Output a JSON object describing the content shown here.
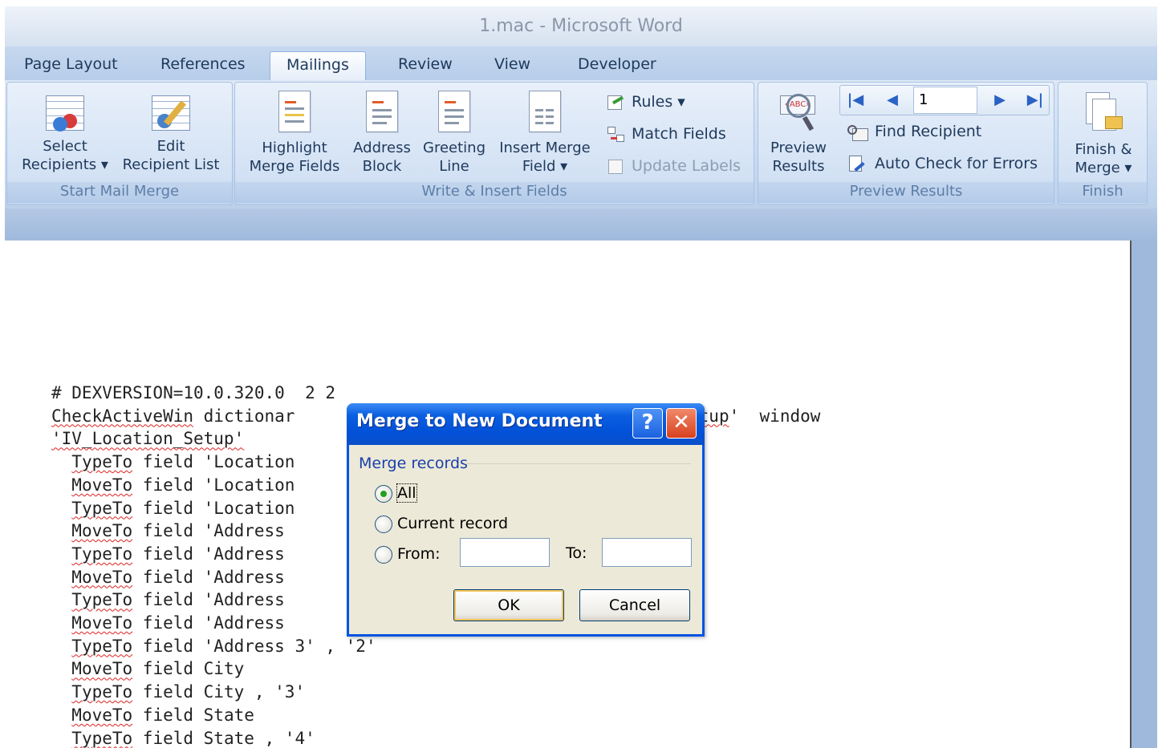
{
  "window": {
    "title": "1.mac - Microsoft Word"
  },
  "tabs": [
    {
      "label": "Page Layout"
    },
    {
      "label": "References"
    },
    {
      "label": "Mailings"
    },
    {
      "label": "Review"
    },
    {
      "label": "View"
    },
    {
      "label": "Developer"
    }
  ],
  "ribbon": {
    "start_group": {
      "label": "Start Mail Merge",
      "select_recipients": "Select\nRecipients ▾",
      "edit_recipient_list": "Edit\nRecipient List"
    },
    "write_group": {
      "label": "Write & Insert Fields",
      "highlight": "Highlight\nMerge Fields",
      "address_block": "Address\nBlock",
      "greeting_line": "Greeting\nLine",
      "insert_merge_field": "Insert Merge\nField ▾",
      "rules": "Rules ▾",
      "match_fields": "Match Fields",
      "update_labels": "Update Labels"
    },
    "preview_group": {
      "label": "Preview Results",
      "preview_results": "Preview\nResults",
      "record_number": "1",
      "find_recipient": "Find Recipient",
      "auto_check": "Auto Check for Errors"
    },
    "finish_group": {
      "label": "Finish",
      "finish_merge": "Finish &\nMerge ▾"
    }
  },
  "document": {
    "line1": "# DEXVERSION=10.0.320.0  2 2",
    "line2a": "CheckActiveWin",
    "line2b": " dictionar",
    "line2c": "on_Setup",
    "line2d": "'  window",
    "line3": "'IV_Location_Setup'",
    "rows": [
      {
        "cmd": "TypeTo",
        "rest": " field 'Location"
      },
      {
        "cmd": "MoveTo",
        "rest": " field 'Location"
      },
      {
        "cmd": "TypeTo",
        "rest": " field 'Location"
      },
      {
        "cmd": "MoveTo",
        "rest": " field 'Address"
      },
      {
        "cmd": "TypeTo",
        "rest": " field 'Address"
      },
      {
        "cmd": "MoveTo",
        "rest": " field 'Address"
      },
      {
        "cmd": "TypeTo",
        "rest": " field 'Address"
      },
      {
        "cmd": "MoveTo",
        "rest": " field 'Address"
      },
      {
        "cmd": "TypeTo",
        "rest": " field 'Address 3' , '2'"
      },
      {
        "cmd": "MoveTo",
        "rest": " field City"
      },
      {
        "cmd": "TypeTo",
        "rest": " field City , '3'"
      },
      {
        "cmd": "MoveTo",
        "rest": " field State"
      },
      {
        "cmd": "TypeTo",
        "rest": " field State , '4'"
      }
    ]
  },
  "dialog": {
    "title": "Merge to New Document",
    "help_label": "?",
    "close_label": "✕",
    "group_label": "Merge records",
    "option_all": "All",
    "option_current": "Current record",
    "option_from": "From:",
    "to_label": "To:",
    "from_value": "",
    "to_value": "",
    "ok_label": "OK",
    "cancel_label": "Cancel",
    "selected_option": "All"
  }
}
